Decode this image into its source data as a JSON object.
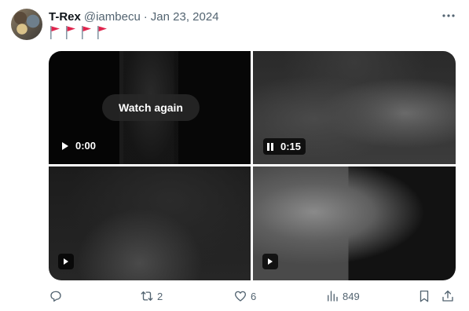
{
  "tweet": {
    "name": "T-Rex",
    "handle": "@iambecu",
    "separator": "·",
    "date": "Jan 23, 2024",
    "flags": [
      "red-flag",
      "red-flag",
      "red-flag",
      "red-flag"
    ]
  },
  "media": {
    "video1": {
      "overlay_button": "Watch again",
      "time": "0:00",
      "state": "paused"
    },
    "video2": {
      "time": "0:15",
      "state": "playing"
    },
    "video3": {
      "state": "paused"
    },
    "video4": {
      "state": "paused"
    }
  },
  "actions": {
    "reply": {
      "icon": "reply-icon",
      "count": ""
    },
    "retweet": {
      "icon": "retweet-icon",
      "count": "2"
    },
    "like": {
      "icon": "heart-icon",
      "count": "6"
    },
    "views": {
      "icon": "views-icon",
      "count": "849"
    },
    "bookmark": {
      "icon": "bookmark-icon"
    },
    "share": {
      "icon": "share-icon"
    }
  },
  "colors": {
    "text": "#0f1419",
    "secondary": "#536471",
    "flag": "#e0244d"
  }
}
